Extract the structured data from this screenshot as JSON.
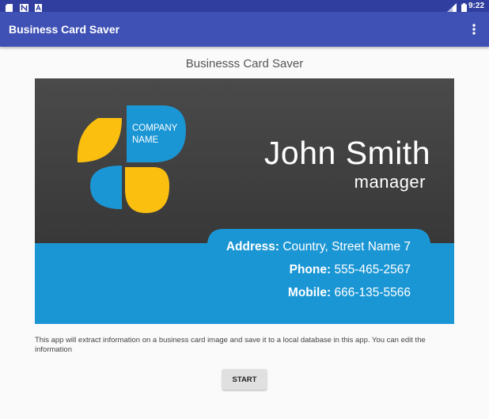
{
  "status_bar": {
    "time": "9:22",
    "icons": [
      "sd-card-icon",
      "n-notification-icon",
      "a-notification-icon",
      "signal-icon",
      "battery-icon"
    ]
  },
  "app_bar": {
    "title": "Business Card Saver",
    "menu_icon": "overflow-menu-icon"
  },
  "main": {
    "heading": "Businesss Card Saver",
    "card": {
      "company_line1": "COMPANY",
      "company_line2": "NAME",
      "name": "John Smith",
      "role": "manager",
      "address_label": "Address:",
      "address_value": "Country, Street Name 7",
      "phone_label": "Phone:",
      "phone_value": "555-465-2567",
      "mobile_label": "Mobile:",
      "mobile_value": "666-135-5566"
    },
    "description": "This app will extract information on a business card image and save it to a local database in this app. You can edit the information",
    "start_label": "START"
  },
  "colors": {
    "status_bar": "#303f9f",
    "app_bar": "#3f51b5",
    "card_dark": "#3a3a3a",
    "card_blue": "#1b96d4",
    "petal_yellow": "#fbbf0f"
  }
}
